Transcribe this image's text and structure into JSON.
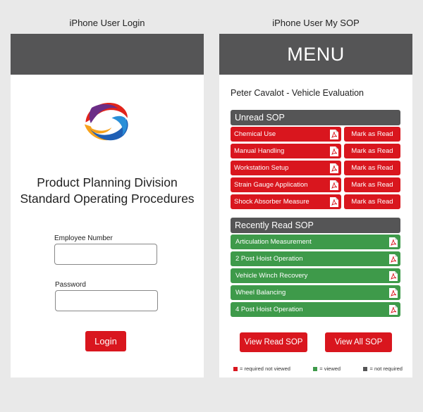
{
  "captions": {
    "left": "iPhone User Login",
    "right": "iPhone User My SOP"
  },
  "login": {
    "title_line1": "Product Planning Division",
    "title_line2": "Standard Operating Procedures",
    "employee_label": "Employee Number",
    "employee_value": "",
    "password_label": "Password",
    "password_value": "",
    "login_button": "Login"
  },
  "sop": {
    "menu_title": "MENU",
    "user_line": "Peter Cavalot - Vehicle Evaluation",
    "unread_header": "Unread SOP",
    "unread_items": [
      {
        "label": "Chemical Use",
        "action": "Mark as Read"
      },
      {
        "label": "Manual Handling",
        "action": "Mark as Read"
      },
      {
        "label": "Workstation Setup",
        "action": "Mark as Read"
      },
      {
        "label": "Strain Gauge Application",
        "action": "Mark as Read"
      },
      {
        "label": "Shock Absorber Measure",
        "action": "Mark as Read"
      }
    ],
    "read_header": "Recently Read SOP",
    "read_items": [
      {
        "label": "Articulation Measurement"
      },
      {
        "label": "2 Post Hoist Operation"
      },
      {
        "label": "Vehicle Winch Recovery"
      },
      {
        "label": "Wheel Balancing"
      },
      {
        "label": "4 Post Hoist Operation"
      }
    ],
    "view_read_button": "View Read SOP",
    "view_all_button": "View All SOP",
    "legend": [
      {
        "label": "= required not viewed",
        "color": "#d9161e"
      },
      {
        "label": "= viewed",
        "color": "#3e9a4a"
      },
      {
        "label": "= not required",
        "color": "#555556"
      }
    ]
  },
  "colors": {
    "accent_red": "#d9161e",
    "viewed_green": "#3e9a4a",
    "header_gray": "#555556"
  },
  "icons": {
    "document": "pdf-icon",
    "logo": "brand-logo"
  }
}
